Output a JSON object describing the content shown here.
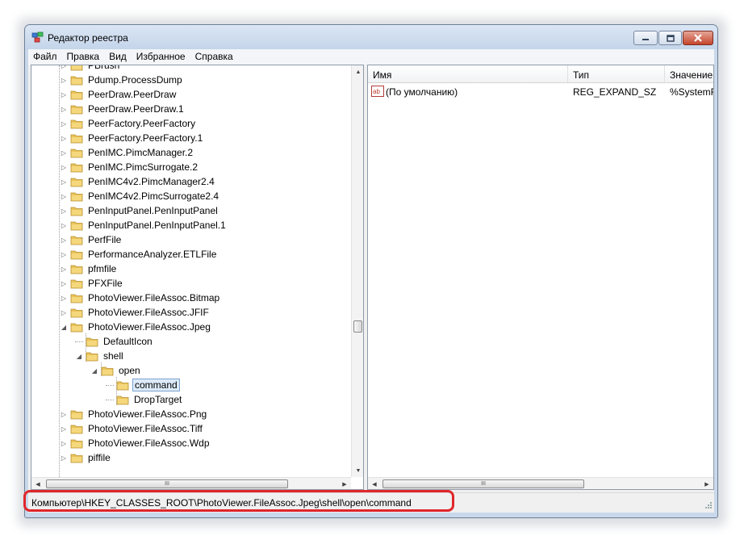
{
  "window": {
    "title": "Редактор реестра",
    "buttons": {
      "minimize": "minimize",
      "maximize": "maximize",
      "close": "close"
    }
  },
  "menu": [
    "Файл",
    "Правка",
    "Вид",
    "Избранное",
    "Справка"
  ],
  "tree": {
    "items": [
      {
        "label": "PBrush",
        "level": 0,
        "expander": "collapsed"
      },
      {
        "label": "Pdump.ProcessDump",
        "level": 0,
        "expander": "collapsed"
      },
      {
        "label": "PeerDraw.PeerDraw",
        "level": 0,
        "expander": "collapsed"
      },
      {
        "label": "PeerDraw.PeerDraw.1",
        "level": 0,
        "expander": "collapsed"
      },
      {
        "label": "PeerFactory.PeerFactory",
        "level": 0,
        "expander": "collapsed"
      },
      {
        "label": "PeerFactory.PeerFactory.1",
        "level": 0,
        "expander": "collapsed"
      },
      {
        "label": "PenIMC.PimcManager.2",
        "level": 0,
        "expander": "collapsed"
      },
      {
        "label": "PenIMC.PimcSurrogate.2",
        "level": 0,
        "expander": "collapsed"
      },
      {
        "label": "PenIMC4v2.PimcManager2.4",
        "level": 0,
        "expander": "collapsed"
      },
      {
        "label": "PenIMC4v2.PimcSurrogate2.4",
        "level": 0,
        "expander": "collapsed"
      },
      {
        "label": "PenInputPanel.PenInputPanel",
        "level": 0,
        "expander": "collapsed"
      },
      {
        "label": "PenInputPanel.PenInputPanel.1",
        "level": 0,
        "expander": "collapsed"
      },
      {
        "label": "PerfFile",
        "level": 0,
        "expander": "collapsed"
      },
      {
        "label": "PerformanceAnalyzer.ETLFile",
        "level": 0,
        "expander": "collapsed"
      },
      {
        "label": "pfmfile",
        "level": 0,
        "expander": "collapsed"
      },
      {
        "label": "PFXFile",
        "level": 0,
        "expander": "collapsed"
      },
      {
        "label": "PhotoViewer.FileAssoc.Bitmap",
        "level": 0,
        "expander": "collapsed"
      },
      {
        "label": "PhotoViewer.FileAssoc.JFIF",
        "level": 0,
        "expander": "collapsed"
      },
      {
        "label": "PhotoViewer.FileAssoc.Jpeg",
        "level": 0,
        "expander": "expanded"
      },
      {
        "label": "DefaultIcon",
        "level": 1,
        "expander": "none"
      },
      {
        "label": "shell",
        "level": 1,
        "expander": "expanded"
      },
      {
        "label": "open",
        "level": 2,
        "expander": "expanded"
      },
      {
        "label": "command",
        "level": 3,
        "expander": "none",
        "selected": true
      },
      {
        "label": "DropTarget",
        "level": 3,
        "expander": "none"
      },
      {
        "label": "PhotoViewer.FileAssoc.Png",
        "level": 0,
        "expander": "collapsed"
      },
      {
        "label": "PhotoViewer.FileAssoc.Tiff",
        "level": 0,
        "expander": "collapsed"
      },
      {
        "label": "PhotoViewer.FileAssoc.Wdp",
        "level": 0,
        "expander": "collapsed"
      },
      {
        "label": "piffile",
        "level": 0,
        "expander": "collapsed"
      }
    ]
  },
  "list": {
    "columns": [
      "Имя",
      "Тип",
      "Значение"
    ],
    "rows": [
      {
        "name": "(По умолчанию)",
        "type": "REG_EXPAND_SZ",
        "value": "%SystemR",
        "icon": "string-value-icon"
      }
    ]
  },
  "scrollbar_glyph": "III",
  "status": {
    "path": "Компьютер\\HKEY_CLASSES_ROOT\\PhotoViewer.FileAssoc.Jpeg\\shell\\open\\command"
  },
  "colors": {
    "highlight": "#e0262b",
    "selection_bg": "#dceaf8",
    "selection_border": "#7da2ce",
    "folder": "#e8c35a"
  }
}
